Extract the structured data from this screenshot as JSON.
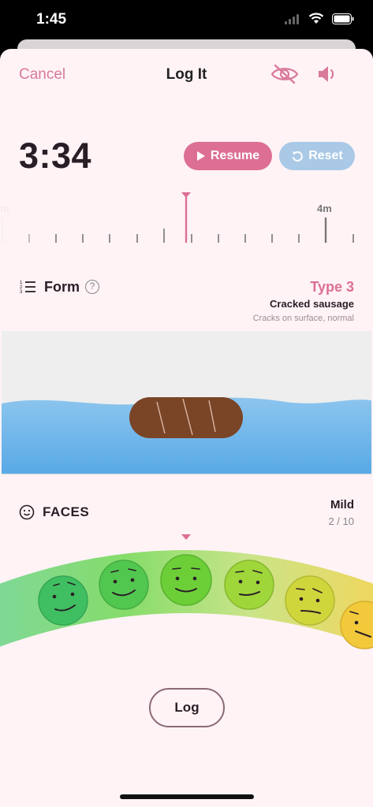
{
  "status_bar": {
    "time": "1:45"
  },
  "header": {
    "cancel_label": "Cancel",
    "title": "Log It",
    "eye_icon": "eye-slash-icon",
    "speaker_icon": "speaker-icon"
  },
  "timer": {
    "display": "3:34",
    "resume_label": "Resume",
    "reset_label": "Reset",
    "ruler_left_label": "m",
    "ruler_right_label": "4m"
  },
  "form": {
    "label": "Form",
    "help": "?",
    "type_label": "Type 3",
    "type_name": "Cracked sausage",
    "type_desc": "Cracks on surface, normal"
  },
  "faces": {
    "label": "FACES",
    "severity": "Mild",
    "score": "2 / 10",
    "selected_index": 2
  },
  "log_label": "Log",
  "colors": {
    "accent": "#dc6f93",
    "reset": "#a9c9e6",
    "background": "#fff3f6",
    "water": "#72b6ea"
  }
}
